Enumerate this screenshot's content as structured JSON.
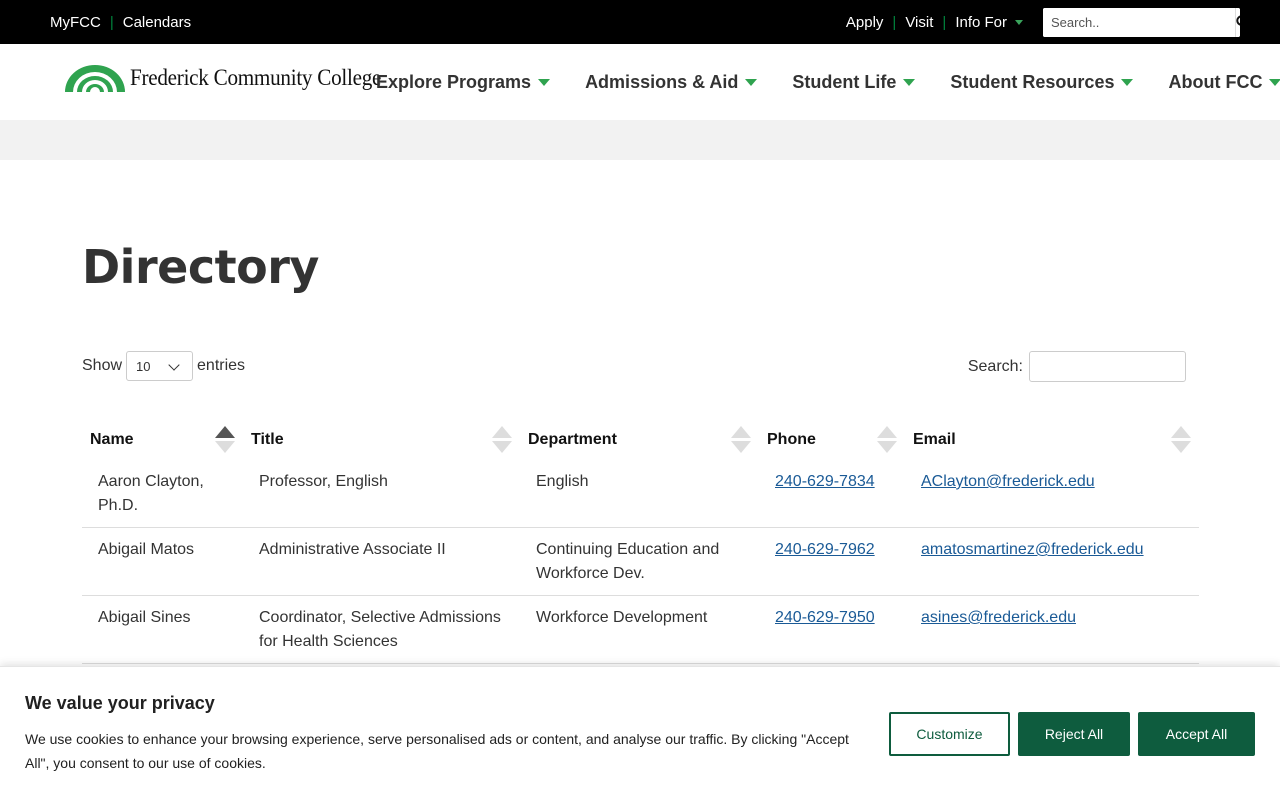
{
  "topbar": {
    "left_links": [
      "MyFCC",
      "Calendars"
    ],
    "right_links": [
      "Apply",
      "Visit",
      "Info For"
    ],
    "search_placeholder": "Search.."
  },
  "logo": {
    "text": "Frederick Community College"
  },
  "nav": {
    "items": [
      {
        "label": "Explore Programs"
      },
      {
        "label": "Admissions & Aid"
      },
      {
        "label": "Student Life"
      },
      {
        "label": "Student Resources"
      },
      {
        "label": "About FCC"
      }
    ]
  },
  "page": {
    "title": "Directory"
  },
  "table_controls": {
    "show_label": "Show",
    "entries_value": "10",
    "entries_label": "entries",
    "search_label": "Search:"
  },
  "table": {
    "columns": [
      "Name",
      "Title",
      "Department",
      "Phone",
      "Email"
    ],
    "rows": [
      {
        "name": "Aaron Clayton, Ph.D.",
        "title": "Professor, English",
        "department": "English",
        "phone": "240-629-7834",
        "email": "AClayton@frederick.edu"
      },
      {
        "name": "Abigail Matos",
        "title": "Administrative Associate II",
        "department": "Continuing Education and Workforce Dev.",
        "phone": "240-629-7962",
        "email": "amatosmartinez@frederick.edu"
      },
      {
        "name": "Abigail Sines",
        "title": "Coordinator, Selective Admissions for Health Sciences",
        "department": "Workforce Development",
        "phone": "240-629-7950",
        "email": "asines@frederick.edu"
      }
    ]
  },
  "cookie": {
    "title": "We value your privacy",
    "text": "We use cookies to enhance your browsing experience, serve personalised ads or content, and analyse our traffic. By clicking \"Accept All\", you consent to our use of cookies.",
    "customize": "Customize",
    "reject": "Reject All",
    "accept": "Accept All"
  },
  "colors": {
    "brand_green": "#00843d",
    "button_green": "#0e5c3e",
    "link_blue": "#1a5a96"
  }
}
